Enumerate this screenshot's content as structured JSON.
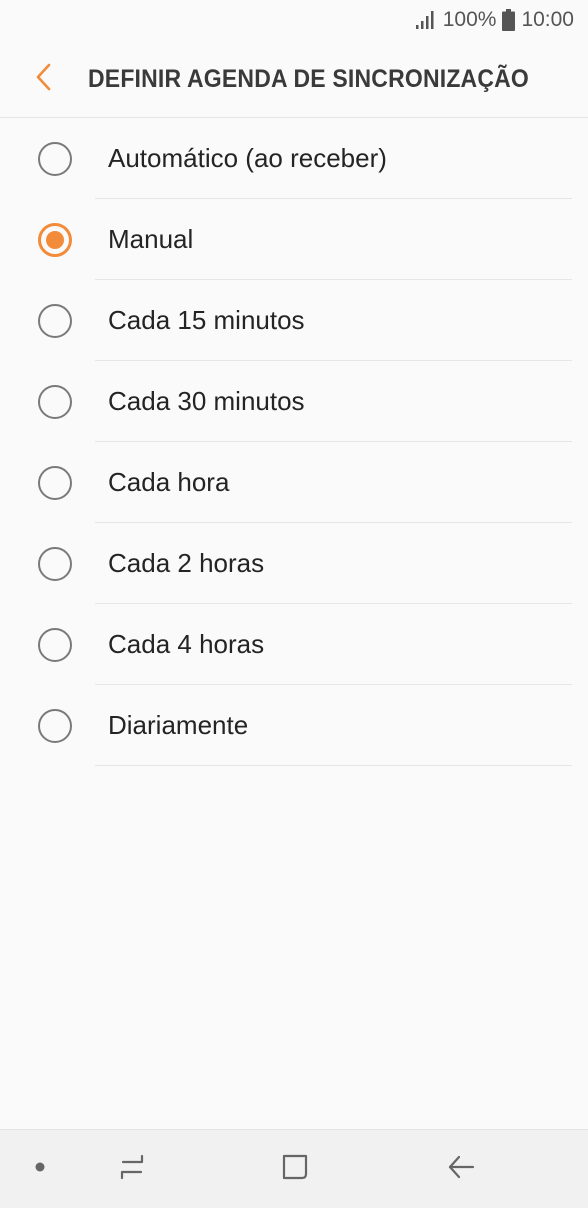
{
  "status_bar": {
    "battery_text": "100%",
    "time": "10:00",
    "icons": [
      "signal-icon",
      "battery-icon"
    ]
  },
  "header": {
    "title": "DEFINIR AGENDA DE SINCRONIZAÇÃO",
    "back_icon": "chevron-left-icon"
  },
  "options": [
    {
      "label": "Automático (ao receber)",
      "selected": false
    },
    {
      "label": "Manual",
      "selected": true
    },
    {
      "label": "Cada 15 minutos",
      "selected": false
    },
    {
      "label": "Cada 30 minutos",
      "selected": false
    },
    {
      "label": "Cada hora",
      "selected": false
    },
    {
      "label": "Cada 2 horas",
      "selected": false
    },
    {
      "label": "Cada 4 horas",
      "selected": false
    },
    {
      "label": "Diariamente",
      "selected": false
    }
  ],
  "nav_bar": {
    "icons": [
      "dot-icon",
      "recent-apps-icon",
      "home-icon",
      "back-arrow-icon"
    ]
  },
  "colors": {
    "accent": "#f28b3a",
    "background": "#fafafa",
    "nav_background": "#f1f1f1"
  }
}
